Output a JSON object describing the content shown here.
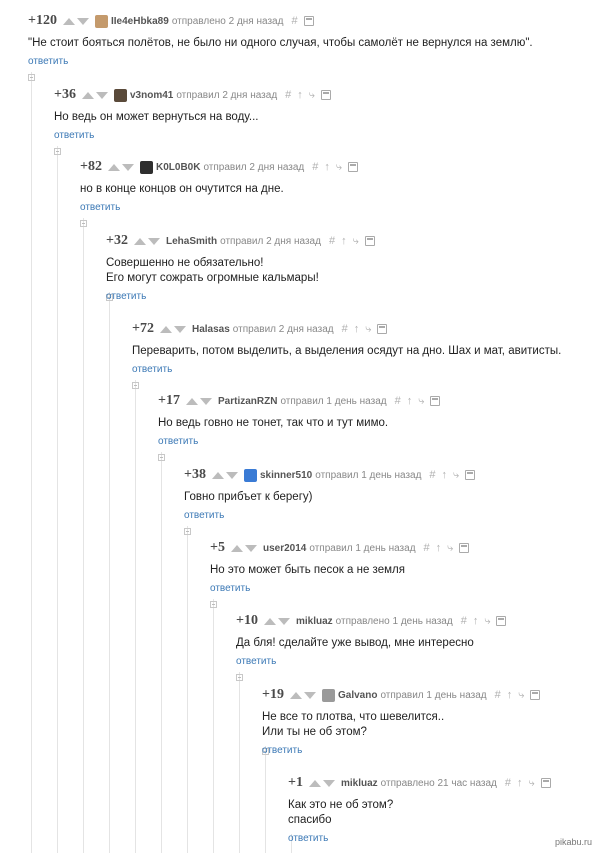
{
  "reply_label": "ответить",
  "comments": [
    {
      "rating": "+120",
      "author": "IIe4eHbka89",
      "time": "отправлено 2 дня назад",
      "lines": [
        "\"Не стоит бояться полётов, не было ни одного случая, чтобы самолёт не вернулся на землю\"."
      ],
      "avatar_color": "#c49a6c",
      "has_user_icons": false
    },
    {
      "rating": "+36",
      "author": "v3nom41",
      "time": "отправил 2 дня назад",
      "lines": [
        "Но ведь он может вернуться на воду..."
      ],
      "avatar_color": "#5a4a3a",
      "has_user_icons": true
    },
    {
      "rating": "+82",
      "author": "K0L0B0K",
      "time": "отправил 2 дня назад",
      "lines": [
        "но в конце концов он очутится на дне."
      ],
      "avatar_color": "#2e2e2e",
      "has_user_icons": true
    },
    {
      "rating": "+32",
      "author": "LehaSmith",
      "time": "отправил 2 дня назад",
      "lines": [
        "Совершенно не обязательно!",
        "Его могут сожрать огромные кальмары!"
      ],
      "avatar_color": "",
      "has_user_icons": true
    },
    {
      "rating": "+72",
      "author": "Halasas",
      "time": "отправил 2 дня назад",
      "lines": [
        "Переварить, потом выделить, а выделения осядут на дно. Шах и мат, авитисты."
      ],
      "avatar_color": "",
      "has_user_icons": true
    },
    {
      "rating": "+17",
      "author": "PartizanRZN",
      "time": "отправил 1 день назад",
      "lines": [
        "Но ведь говно не тонет, так что и тут мимо."
      ],
      "avatar_color": "",
      "has_user_icons": true
    },
    {
      "rating": "+38",
      "author": "skinner510",
      "time": "отправил 1 день назад",
      "lines": [
        "Говно прибъет к берегу)"
      ],
      "avatar_color": "#3a7bd5",
      "has_user_icons": true
    },
    {
      "rating": "+5",
      "author": "user2014",
      "time": "отправил 1 день назад",
      "lines": [
        "Но это может быть песок а не земля"
      ],
      "avatar_color": "",
      "has_user_icons": true
    },
    {
      "rating": "+10",
      "author": "mikluaz",
      "time": "отправлено 1 день назад",
      "lines": [
        "Да бля! сделайте уже вывод, мне интересно"
      ],
      "avatar_color": "",
      "has_user_icons": true
    },
    {
      "rating": "+19",
      "author": "Galvano",
      "time": "отправил 1 день назад",
      "lines": [
        "Не все то плотва, что шевелится..",
        "Или ты не об этом?"
      ],
      "avatar_color": "#9a9a9a",
      "has_user_icons": true
    },
    {
      "rating": "+1",
      "author": "mikluaz",
      "time": "отправлено 21 час назад",
      "lines": [
        "Как это не об этом?",
        "спасибо"
      ],
      "avatar_color": "",
      "has_user_icons": true
    }
  ],
  "watermark": "pikabu.ru"
}
